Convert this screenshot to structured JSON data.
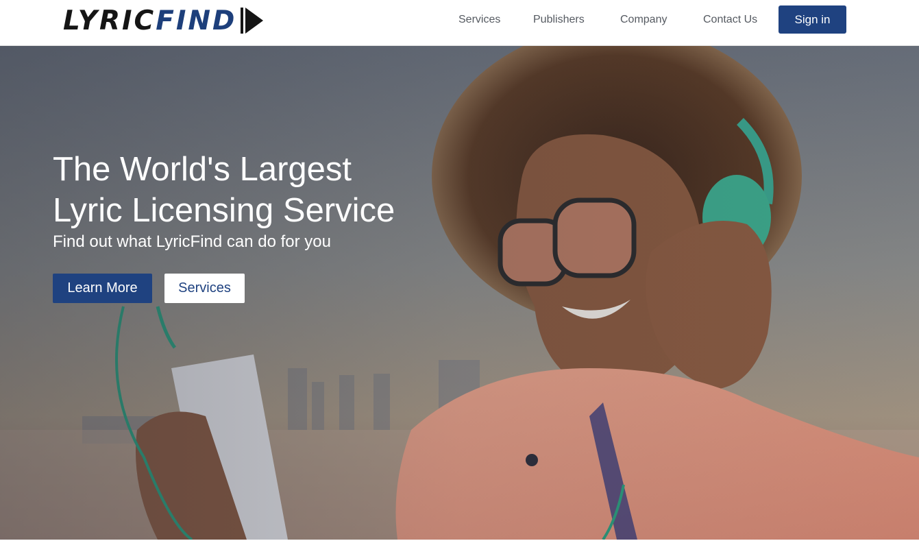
{
  "brand": {
    "part1": "LYRIC",
    "part2": "FIND",
    "logo_icon": "play-icon"
  },
  "nav": {
    "items": [
      {
        "label": "Services"
      },
      {
        "label": "Publishers"
      },
      {
        "label": "Company"
      },
      {
        "label": "Contact Us"
      }
    ],
    "signin_label": "Sign in"
  },
  "hero": {
    "title_line1": "The World's Largest",
    "title_line2": "Lyric Licensing Service",
    "subtitle": "Find out what LyricFind can do for you",
    "primary_button": "Learn More",
    "secondary_button": "Services"
  },
  "colors": {
    "accent": "#1f4280",
    "logo_dark": "#151515",
    "logo_blue": "#1d3f7b",
    "nav_text": "#555a61"
  }
}
